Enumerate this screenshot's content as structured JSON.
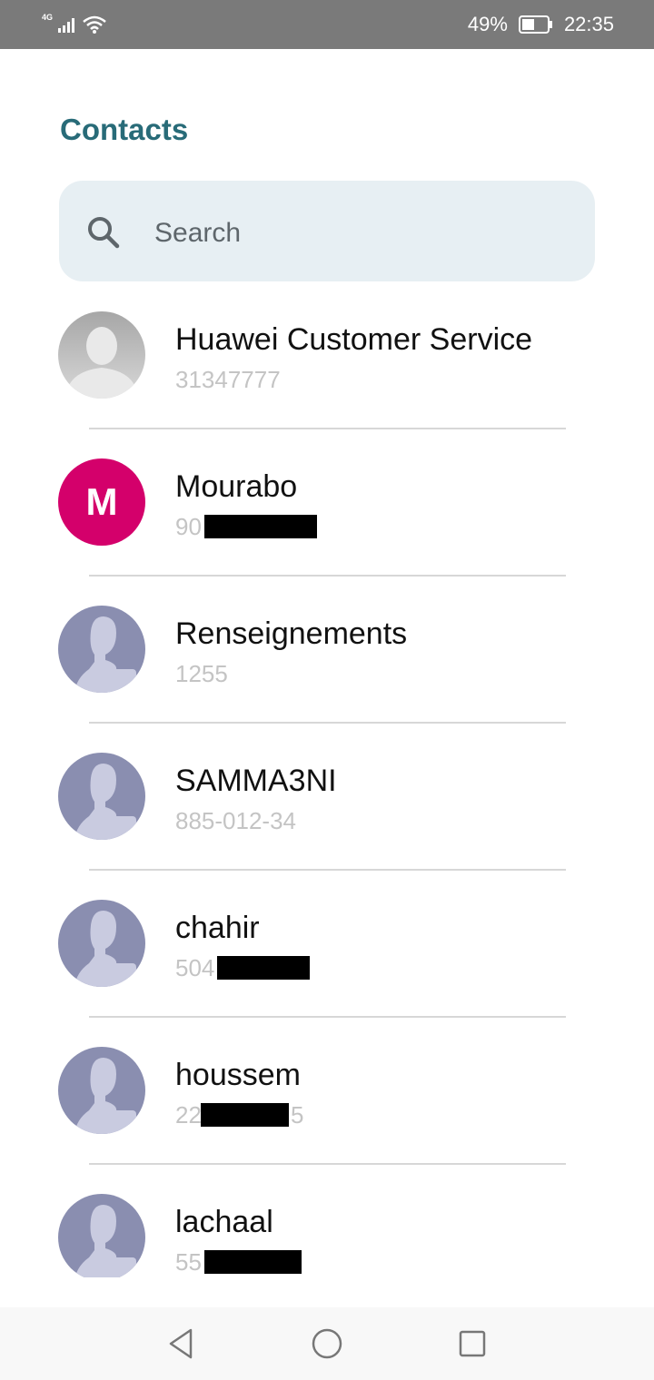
{
  "status_bar": {
    "network_type": "4G",
    "battery_percent": "49%",
    "time": "22:35",
    "icons": [
      "signal-icon",
      "wifi-icon",
      "battery-icon"
    ]
  },
  "header": {
    "title": "Contacts"
  },
  "search": {
    "placeholder": "Search",
    "value": ""
  },
  "contacts": [
    {
      "name": "Huawei Customer Service",
      "number": "31347777",
      "avatar": "default-person"
    },
    {
      "name": "Mourabo",
      "number": "90",
      "avatar": "letter",
      "initial": "M",
      "color": "#d4006b",
      "number_redacted": true
    },
    {
      "name": "Renseignements",
      "number": "1255",
      "avatar": "generic-person"
    },
    {
      "name": "SAMMA3NI",
      "number": "885-012-34",
      "avatar": "generic-person"
    },
    {
      "name": "chahir",
      "number": "504",
      "avatar": "generic-person",
      "number_redacted": true
    },
    {
      "name": "houssem",
      "number": "22",
      "number_suffix": "5",
      "avatar": "generic-person",
      "number_redacted": true
    },
    {
      "name": "lachaal",
      "number": "55",
      "avatar": "generic-person",
      "number_redacted": true
    }
  ],
  "nav_bar": {
    "buttons": [
      "back-icon",
      "home-icon",
      "recents-icon"
    ]
  },
  "colors": {
    "title": "#286b78",
    "search_bg": "#e7eff3",
    "generic_avatar": "#8a8eb0",
    "status_bar": "#7a7a7a"
  }
}
